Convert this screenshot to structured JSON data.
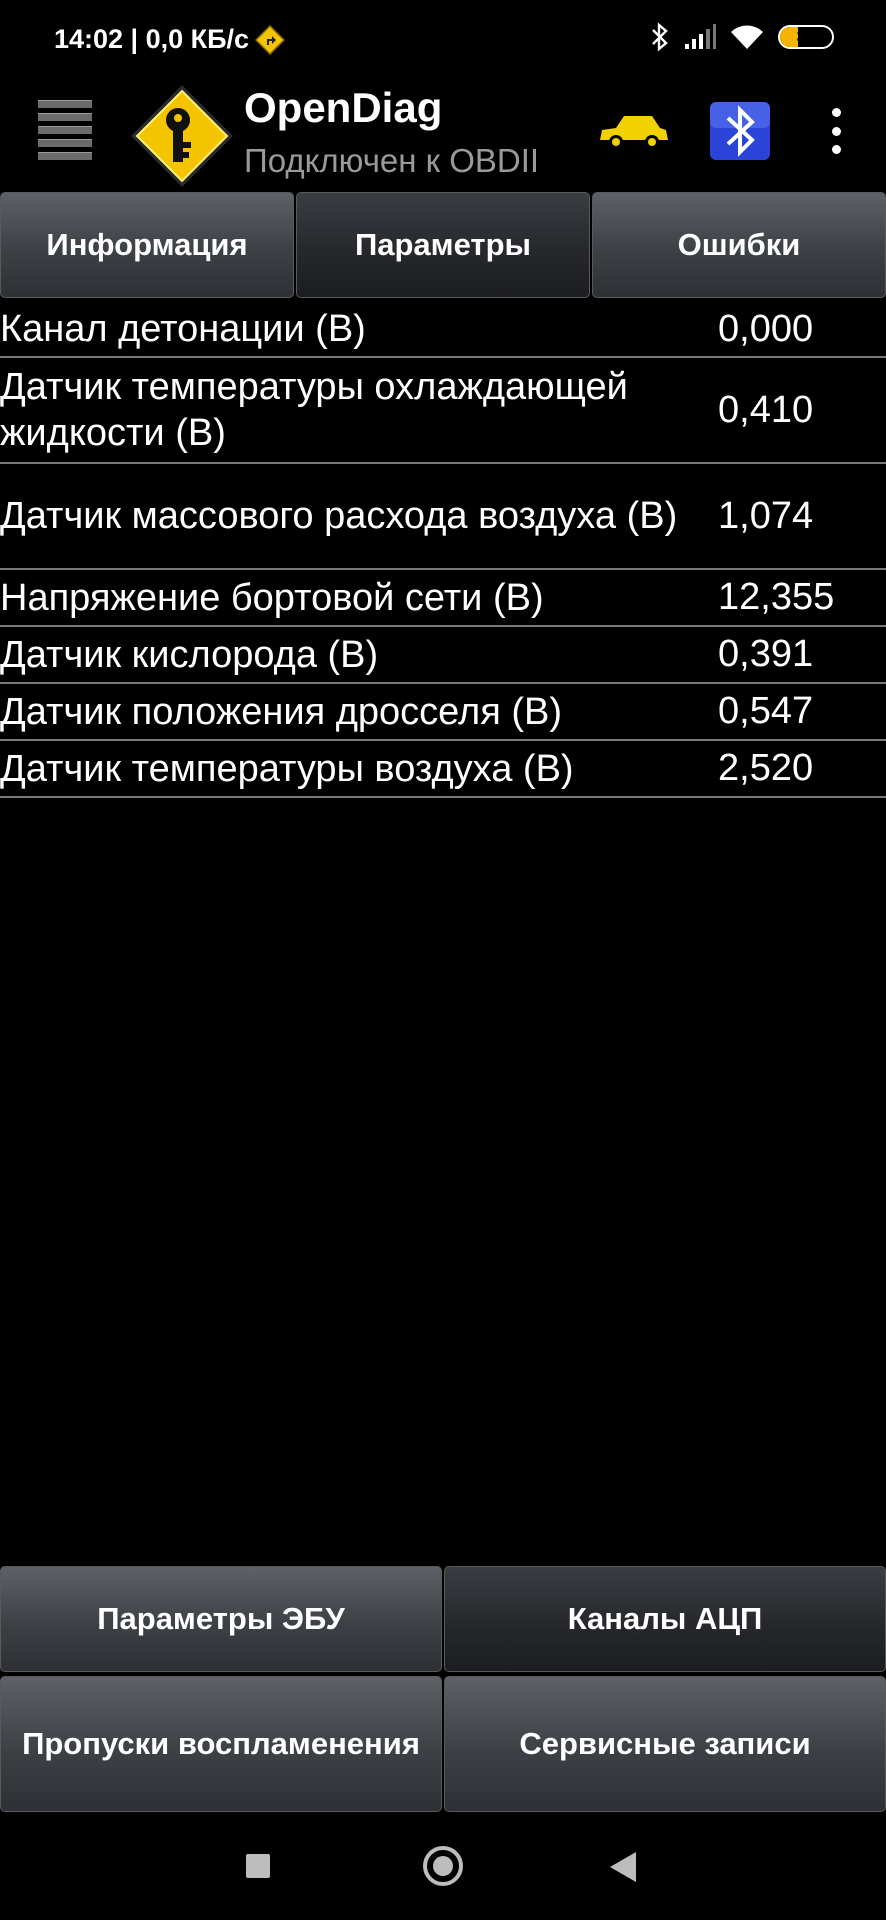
{
  "status_bar": {
    "time_speed": "14:02 | 0,0 КБ/с",
    "battery": "34",
    "battery_level_percent": 34,
    "icons": [
      "navigation-diamond-icon",
      "bluetooth-icon",
      "signal-icon",
      "wifi-icon",
      "battery-icon"
    ]
  },
  "app_bar": {
    "title": "OpenDiag",
    "subtitle": "Подключен к OBDII",
    "icons": [
      "menu-icon",
      "app-logo-key-icon",
      "car-icon",
      "ecu-bluetooth-icon",
      "overflow-menu-icon"
    ]
  },
  "tabs": [
    {
      "label": "Информация",
      "active": false
    },
    {
      "label": "Параметры",
      "active": true
    },
    {
      "label": "Ошибки",
      "active": false
    }
  ],
  "parameters": [
    {
      "name": "Канал детонации (В)",
      "value": "0,000"
    },
    {
      "name": "Датчик температуры охлаждающей жидкости (В)",
      "value": "0,410"
    },
    {
      "name": "Датчик массового расхода воздуха (В)",
      "value": "1,074"
    },
    {
      "name": "Напряжение бортовой сети (В)",
      "value": "12,355"
    },
    {
      "name": "Датчик кислорода (В)",
      "value": "0,391"
    },
    {
      "name": "Датчик положения дросселя (В)",
      "value": "0,547"
    },
    {
      "name": "Датчик температуры воздуха (В)",
      "value": "2,520"
    }
  ],
  "bottom_buttons": [
    {
      "label": "Параметры ЭБУ",
      "active": false
    },
    {
      "label": "Каналы АЦП",
      "active": true
    },
    {
      "label": "Пропуски воспламенения",
      "active": false
    },
    {
      "label": "Сервисные записи",
      "active": false
    }
  ],
  "colors": {
    "background": "#000000",
    "button_gradient_top": "#5e6167",
    "button_gradient_bottom": "#2e3035",
    "active_button": "#26282c",
    "logo_yellow": "#f5c400",
    "car_yellow": "#f2d100",
    "bt_blue": "#2a44d8",
    "subtitle_gray": "#9a9a9a",
    "divider": "#7a7a7a",
    "battery_orange": "#f4b400"
  }
}
